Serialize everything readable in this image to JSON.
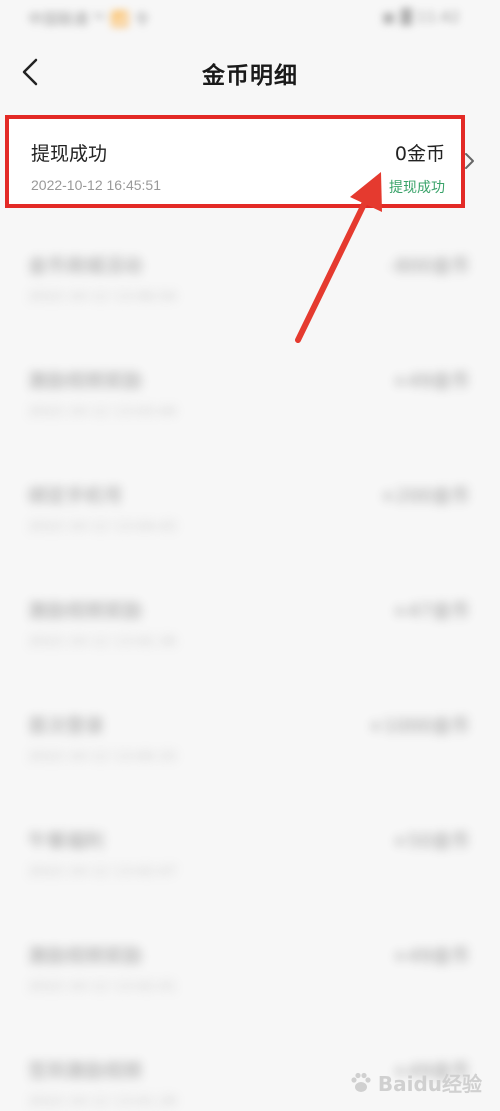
{
  "status_bar": {
    "left": "中国联通 ⁵ᴳ 📶 令",
    "right": "▣ ▓ 11:42"
  },
  "header": {
    "title": "金币明细"
  },
  "highlighted_record": {
    "name": "提现成功",
    "time": "2022-10-12 16:45:51",
    "amount": "0金币",
    "status": "提现成功"
  },
  "records": [
    {
      "name": "金币商城活动",
      "time": "2022-10-12 13:06:54",
      "amount": "-800金币"
    },
    {
      "name": "激励视频奖励",
      "time": "2022-10-12 13:03:44",
      "amount": "+49金币"
    },
    {
      "name": "绑定手机号",
      "time": "2022-10-12 13:04:43",
      "amount": "+200金币"
    },
    {
      "name": "激励视频奖励",
      "time": "2022-10-12 13:02:36",
      "amount": "+47金币"
    },
    {
      "name": "首次登录",
      "time": "2022-10-12 13:00:33",
      "amount": "+1000金币"
    },
    {
      "name": "午餐福利",
      "time": "2022-10-12 13:02:07",
      "amount": "+50金币"
    },
    {
      "name": "激励视频奖励",
      "time": "2022-10-12 13:02:01",
      "amount": "+49金币"
    },
    {
      "name": "签到激励视频",
      "time": "2022-10-12 13:01:29",
      "amount": "+49金币"
    }
  ],
  "watermark": {
    "text": "Baidu经验"
  },
  "colors": {
    "highlight": "#e32a26",
    "status_green": "#3aa36a",
    "background": "#f7f7f7"
  },
  "icons": {
    "back": "chevron-left-icon",
    "row_chevron": "chevron-right-icon",
    "annotation": "red-arrow-icon"
  }
}
